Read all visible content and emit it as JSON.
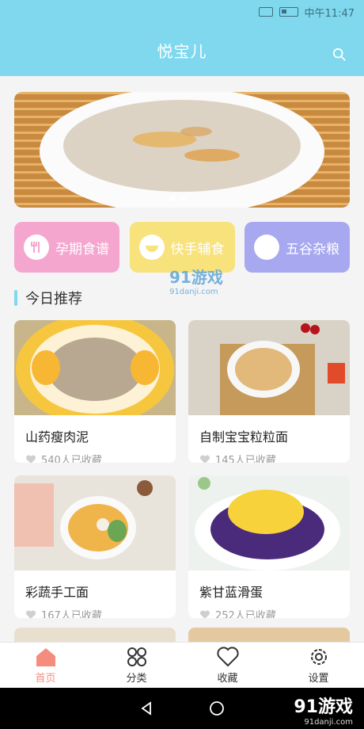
{
  "status": {
    "time": "中午11:47"
  },
  "header": {
    "title": "悦宝儿"
  },
  "categories": [
    {
      "label": "孕期食谱",
      "color": "#f4a6cf"
    },
    {
      "label": "快手辅食",
      "color": "#f7e27c"
    },
    {
      "label": "五谷杂粮",
      "color": "#a7a8f0"
    }
  ],
  "section": {
    "title": "今日推荐"
  },
  "recipes": [
    {
      "name": "山药瘦肉泥",
      "fav": "540人已收藏"
    },
    {
      "name": "自制宝宝粒粒面",
      "fav": "145人已收藏"
    },
    {
      "name": "彩蔬手工面",
      "fav": "167人已收藏"
    },
    {
      "name": "紫甘蓝滑蛋",
      "fav": "252人已收藏"
    }
  ],
  "tabs": [
    {
      "label": "首页"
    },
    {
      "label": "分类"
    },
    {
      "label": "收藏"
    },
    {
      "label": "设置"
    }
  ],
  "watermark": {
    "text": "91游戏",
    "sub": "91danji.com"
  },
  "colors": {
    "header": "#7fd8ee",
    "active_tab": "#f58d7f"
  }
}
